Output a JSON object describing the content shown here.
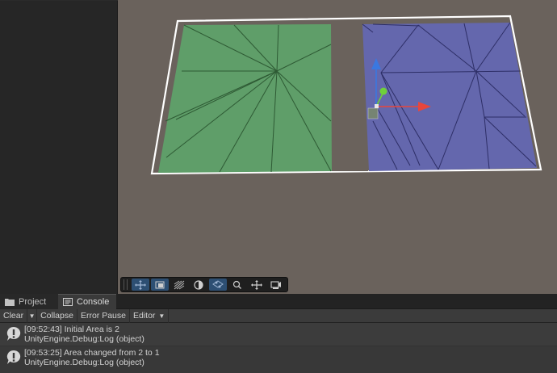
{
  "tabs": [
    {
      "label": "Project",
      "icon": "folder-icon"
    },
    {
      "label": "Console",
      "icon": "console-icon"
    }
  ],
  "console_toolbar": {
    "clear": "Clear",
    "collapse": "Collapse",
    "error_pause": "Error Pause",
    "editor": "Editor"
  },
  "logs": [
    {
      "message": "[09:52:43] Initial Area is 2",
      "stack": "UnityEngine.Debug:Log (object)"
    },
    {
      "message": "[09:53:25] Area changed from 2 to 1",
      "stack": "UnityEngine.Debug:Log (object)"
    }
  ],
  "scene_tools": [
    {
      "icon": "view-tool-icon"
    },
    {
      "icon": "move-tool-icon",
      "active": true
    },
    {
      "icon": "rotate-tool-icon"
    },
    {
      "icon": "scale-tool-icon"
    },
    {
      "icon": "rect-tool-icon",
      "active": true
    },
    {
      "icon": "zoom-icon"
    },
    {
      "icon": "transform-tool-icon"
    },
    {
      "icon": "camera-icon"
    }
  ],
  "colors": {
    "scene_background": "#6a625c",
    "area_green": "#5f9e69",
    "area_blue": "#6467ad",
    "selection_outline": "#ffffff",
    "active_tool": "#2d4f73"
  }
}
